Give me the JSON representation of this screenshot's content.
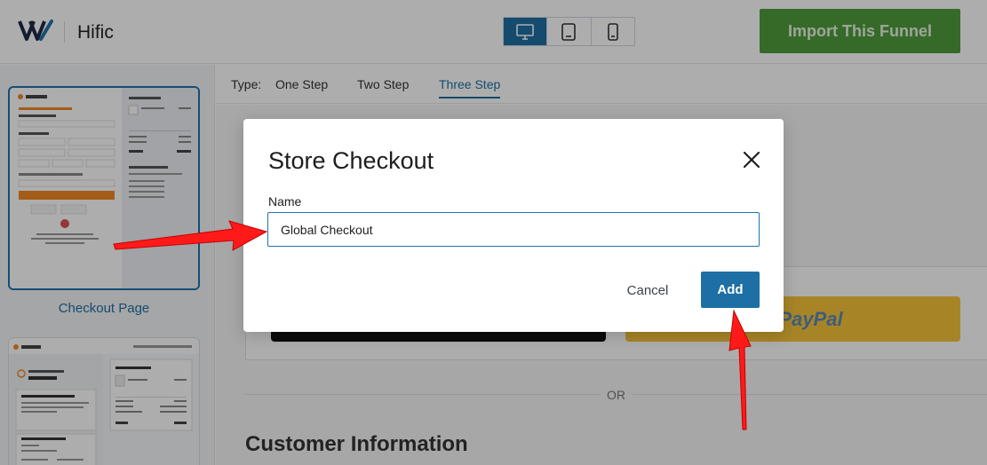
{
  "header": {
    "app_name": "Hific",
    "import_button": "Import This Funnel",
    "devices": [
      "desktop-icon",
      "tablet-icon",
      "mobile-icon"
    ],
    "active_device": "desktop"
  },
  "sidebar": {
    "selected_caption": "Checkout Page"
  },
  "typebar": {
    "label": "Type:",
    "tabs": [
      "One Step",
      "Two Step",
      "Three Step"
    ],
    "active_tab": "Three Step"
  },
  "background_page": {
    "or_text": "OR",
    "section_title": "Customer Information",
    "paypal_text": "PayPal"
  },
  "modal": {
    "title": "Store Checkout",
    "name_label": "Name",
    "name_value": "Global Checkout",
    "cancel_label": "Cancel",
    "add_label": "Add"
  },
  "colors": {
    "accent": "#1e6fa3",
    "import_green": "#4e9c3d",
    "annotation_red": "#ff1a1a"
  }
}
